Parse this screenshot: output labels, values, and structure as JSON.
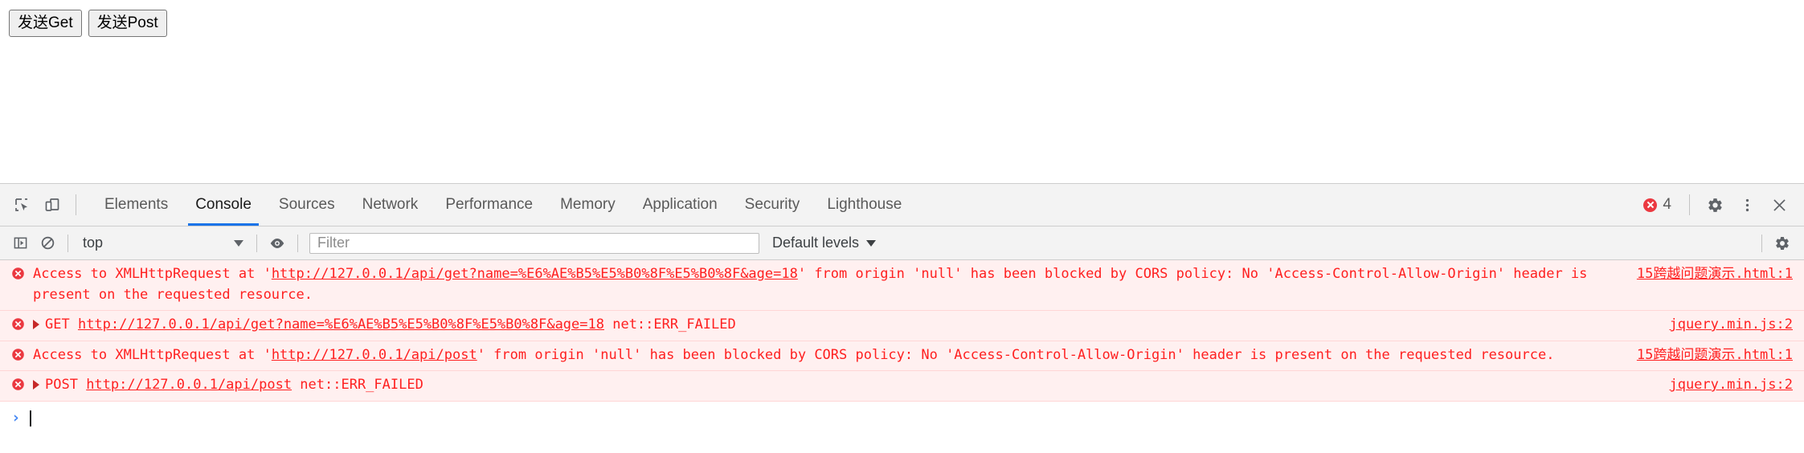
{
  "page": {
    "buttons": [
      {
        "label": "发送Get",
        "name": "send-get-button"
      },
      {
        "label": "发送Post",
        "name": "send-post-button"
      }
    ]
  },
  "devtools": {
    "toolbar_icons": {
      "inspect": "inspect-element-icon",
      "device": "device-toolbar-icon"
    },
    "tabs": [
      {
        "label": "Elements",
        "active": false
      },
      {
        "label": "Console",
        "active": true
      },
      {
        "label": "Sources",
        "active": false
      },
      {
        "label": "Network",
        "active": false
      },
      {
        "label": "Performance",
        "active": false
      },
      {
        "label": "Memory",
        "active": false
      },
      {
        "label": "Application",
        "active": false
      },
      {
        "label": "Security",
        "active": false
      },
      {
        "label": "Lighthouse",
        "active": false
      }
    ],
    "error_badge": {
      "count": "4",
      "icon": "error-circle-icon"
    },
    "right_icons": {
      "settings": "gear-icon",
      "more": "more-vertical-icon",
      "close": "close-icon"
    },
    "filterbar": {
      "sidebar_toggle_icon": "console-sidebar-icon",
      "clear_icon": "clear-console-icon",
      "context": "top",
      "eye_icon": "eye-icon",
      "filter_placeholder": "Filter",
      "filter_value": "",
      "levels": "Default levels",
      "settings_icon": "gear-icon"
    },
    "console": {
      "messages": [
        {
          "type": "error",
          "expandable": false,
          "segments": [
            {
              "text": "Access to XMLHttpRequest at '",
              "link": false
            },
            {
              "text": "http://127.0.0.1/api/get?name=%E6%AE%B5%E5%B0%8F%E5%B0%8F&age=18",
              "link": true
            },
            {
              "text": "' from origin 'null' has been blocked by CORS policy: No 'Access-Control-Allow-Origin' header is present on the requested resource.",
              "link": false
            }
          ],
          "source": "15跨越问题演示.html:1"
        },
        {
          "type": "error",
          "expandable": true,
          "segments": [
            {
              "text": "GET ",
              "link": false
            },
            {
              "text": "http://127.0.0.1/api/get?name=%E6%AE%B5%E5%B0%8F%E5%B0%8F&age=18",
              "link": true
            },
            {
              "text": " net::ERR_FAILED",
              "link": false
            }
          ],
          "source": "jquery.min.js:2"
        },
        {
          "type": "error",
          "expandable": false,
          "segments": [
            {
              "text": "Access to XMLHttpRequest at '",
              "link": false
            },
            {
              "text": "http://127.0.0.1/api/post",
              "link": true
            },
            {
              "text": "' from origin 'null' has been blocked by CORS policy: No 'Access-Control-Allow-Origin' header is present on the requested resource.",
              "link": false
            }
          ],
          "source": "15跨越问题演示.html:1"
        },
        {
          "type": "error",
          "expandable": true,
          "segments": [
            {
              "text": "POST ",
              "link": false
            },
            {
              "text": "http://127.0.0.1/api/post",
              "link": true
            },
            {
              "text": " net::ERR_FAILED",
              "link": false
            }
          ],
          "source": "jquery.min.js:2"
        }
      ],
      "prompt": {
        "arrow": "›",
        "value": ""
      }
    }
  },
  "colors": {
    "error_text": "#ff2020",
    "error_bg": "#fff0f0",
    "accent": "#1a73e8",
    "toolbar_bg": "#f3f3f3"
  }
}
